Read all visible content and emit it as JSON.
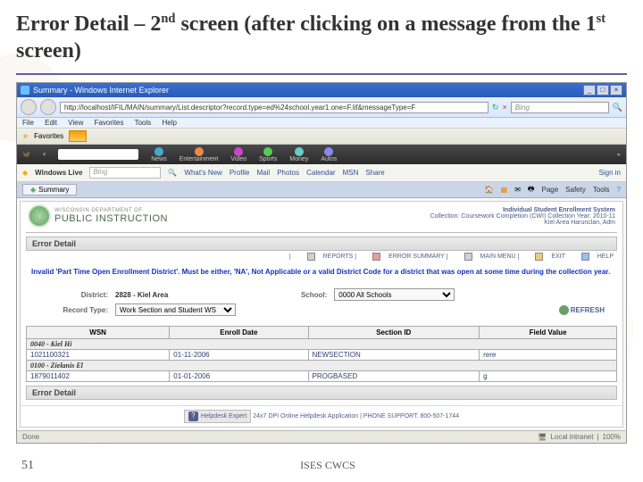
{
  "slide": {
    "title_a": "Error Detail – 2",
    "title_sup1": "nd",
    "title_b": " screen (after clicking on a message from the 1",
    "title_sup2": "st",
    "title_c": " screen)",
    "page_number": "51",
    "footer": "ISES CWCS"
  },
  "ie": {
    "window_title": "Summary - Windows Internet Explorer",
    "url": "http://localhost/IFIL/MAIN/summary/List.descriptor?record.type=ed%24school.year1.one=F.lif&messageType=F",
    "search_placeholder": "Bing",
    "menu": [
      "File",
      "Edit",
      "View",
      "Favorites",
      "Tools",
      "Help"
    ],
    "fav_label": "Favorites",
    "tab_label": "Summary",
    "status_left": "Done",
    "status_zone": "Local intranet",
    "status_zoom": "100%"
  },
  "msn": {
    "items": [
      "News",
      "Entertainment",
      "Video",
      "Sports",
      "Money",
      "Autos"
    ]
  },
  "wlive": {
    "label": "Windows Live",
    "placeholder": "Bing",
    "items": [
      "What's New",
      "Profile",
      "Mail",
      "Photos",
      "Calendar",
      "MSN",
      "Share"
    ],
    "signin": "Sign in"
  },
  "tabrow": {
    "right": [
      "Page",
      "Safety",
      "Tools"
    ]
  },
  "app": {
    "dpi_small": "WISCONSIN DEPARTMENT OF",
    "dpi_main": "PUBLIC INSTRUCTION",
    "sys1": "Individual Student Enrollment System",
    "sys2": "Collection: Coursework Completion (CWI)    Collection Year: 2010-11",
    "sys3": "Kiel Area    Harunclan, Adm",
    "section": "Error Detail",
    "links": [
      "REPORTS",
      "ERROR SUMMARY",
      "MAIN MENU",
      "EXIT",
      "HELP"
    ],
    "error_msg": "Invalid 'Part Time Open Enrollment District'. Must be either, 'NA', Not Applicable or a valid District Code for a district that was open at some time during the collection year.",
    "filters": {
      "district_label": "District:",
      "district_value": "2828 - Kiel Area",
      "school_label": "School:",
      "school_value": "0000 All Schools",
      "rectype_label": "Record Type:",
      "rectype_value": "Work Section and Student WS",
      "refresh": "REFRESH"
    },
    "table": {
      "headers": [
        "WSN",
        "Enroll Date",
        "Section ID",
        "Field Value"
      ],
      "rows": [
        {
          "type": "group",
          "label": "0040 - Kiel Hi"
        },
        {
          "type": "data",
          "cells": [
            "1021100321",
            "01-11-2006",
            "NEWSECTION",
            "rere"
          ]
        },
        {
          "type": "group",
          "label": "0100 - Zielanis El"
        },
        {
          "type": "data",
          "cells": [
            "1879011402",
            "01-01-2006",
            "PROGBASED",
            "g"
          ]
        }
      ]
    },
    "section2": "Error Detail",
    "help_box": "Helpdesk Expert",
    "help_text": "24x7 DPI Online Helpdesk Application | PHONE SUPPORT: 800-507-1744"
  }
}
